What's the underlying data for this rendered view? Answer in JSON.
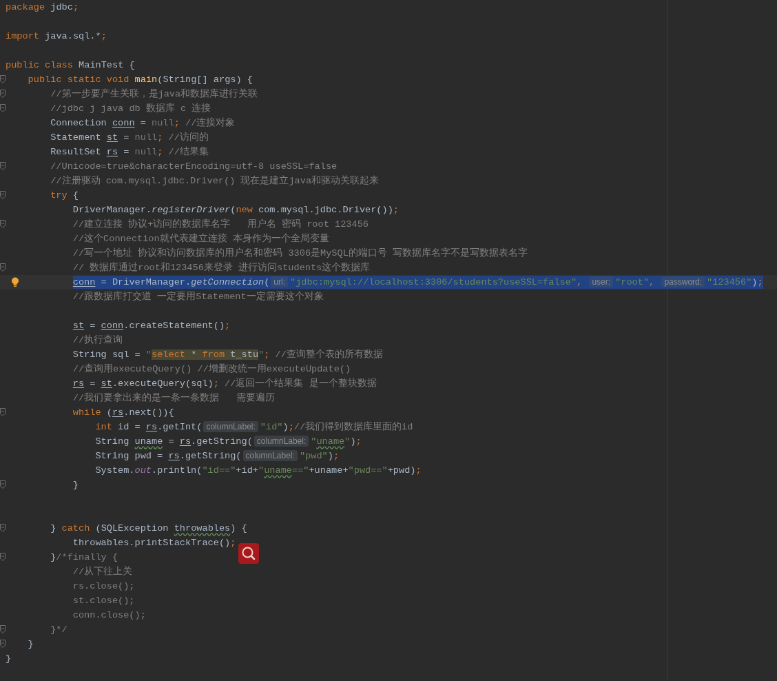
{
  "editor": {
    "lines": [
      {
        "kind": "code",
        "fold": false,
        "selected": false,
        "tokens": [
          {
            "kind": "kw",
            "text": "package"
          },
          {
            "kind": "plain",
            "text": " jdbc"
          },
          {
            "kind": "punct",
            "text": ";"
          }
        ]
      },
      {
        "kind": "blank"
      },
      {
        "kind": "code",
        "fold": false,
        "selected": false,
        "tokens": [
          {
            "kind": "kw",
            "text": "import"
          },
          {
            "kind": "plain",
            "text": " java.sql.*"
          },
          {
            "kind": "punct",
            "text": ";"
          }
        ]
      },
      {
        "kind": "blank"
      },
      {
        "kind": "code",
        "fold": false,
        "selected": false,
        "tokens": [
          {
            "kind": "kw",
            "text": "public class"
          },
          {
            "kind": "plain",
            "text": " MainTest {"
          }
        ],
        "children": [
          {
            "kind": "code",
            "fold": true,
            "selected": false,
            "tokens": [
              {
                "kind": "kw",
                "text": "public static void "
              },
              {
                "kind": "decl",
                "text": "main"
              },
              {
                "kind": "plain",
                "text": "(String[] args) {"
              }
            ],
            "children": [
              {
                "kind": "code",
                "fold": true,
                "selected": false,
                "tokens": [
                  {
                    "kind": "comment",
                    "text": "//第一步要产生关联，是java和数据库进行关联"
                  }
                ]
              },
              {
                "kind": "code",
                "fold": true,
                "selected": false,
                "tokens": [
                  {
                    "kind": "comment",
                    "text": "//jdbc j java db 数据库 c 连接"
                  }
                ]
              },
              {
                "kind": "code",
                "fold": false,
                "selected": false,
                "tokens": [
                  {
                    "kind": "plain",
                    "text": "Connection "
                  },
                  {
                    "kind": "var",
                    "text": "conn"
                  },
                  {
                    "kind": "plain",
                    "text": " = "
                  },
                  {
                    "kind": "null",
                    "text": "null"
                  },
                  {
                    "kind": "punct",
                    "text": "; "
                  },
                  {
                    "kind": "comment",
                    "text": "//连接对象"
                  }
                ]
              },
              {
                "kind": "code",
                "fold": false,
                "selected": false,
                "tokens": [
                  {
                    "kind": "plain",
                    "text": "Statement "
                  },
                  {
                    "kind": "var",
                    "text": "st"
                  },
                  {
                    "kind": "plain",
                    "text": " = "
                  },
                  {
                    "kind": "null",
                    "text": "null"
                  },
                  {
                    "kind": "punct",
                    "text": "; "
                  },
                  {
                    "kind": "comment",
                    "text": "//访问的"
                  }
                ]
              },
              {
                "kind": "code",
                "fold": false,
                "selected": false,
                "tokens": [
                  {
                    "kind": "plain",
                    "text": "ResultSet "
                  },
                  {
                    "kind": "var",
                    "text": "rs"
                  },
                  {
                    "kind": "plain",
                    "text": " = "
                  },
                  {
                    "kind": "null",
                    "text": "null"
                  },
                  {
                    "kind": "punct",
                    "text": "; "
                  },
                  {
                    "kind": "comment",
                    "text": "//结果集"
                  }
                ]
              },
              {
                "kind": "code",
                "fold": true,
                "selected": false,
                "tokens": [
                  {
                    "kind": "comment",
                    "text": "//Unicode=true&characterEncoding=utf-8 useSSL=false"
                  }
                ]
              },
              {
                "kind": "code",
                "fold": false,
                "selected": false,
                "tokens": [
                  {
                    "kind": "comment",
                    "text": "//注册驱动 com.mysql.jdbc.Driver() 现在是建立java和驱动关联起来"
                  }
                ]
              },
              {
                "kind": "code",
                "fold": true,
                "selected": false,
                "tokens": [
                  {
                    "kind": "kw",
                    "text": "try"
                  },
                  {
                    "kind": "plain",
                    "text": " {"
                  }
                ],
                "children": [
                  {
                    "kind": "code",
                    "fold": false,
                    "selected": false,
                    "tokens": [
                      {
                        "kind": "plain",
                        "text": "DriverManager."
                      },
                      {
                        "kind": "italic",
                        "text": "registerDriver"
                      },
                      {
                        "kind": "plain",
                        "text": "("
                      },
                      {
                        "kind": "kw",
                        "text": "new"
                      },
                      {
                        "kind": "plain",
                        "text": " com.mysql.jdbc.Driver())"
                      },
                      {
                        "kind": "punct",
                        "text": ";"
                      }
                    ]
                  },
                  {
                    "kind": "code",
                    "fold": true,
                    "selected": false,
                    "tokens": [
                      {
                        "kind": "comment",
                        "text": "//建立连接 协议+访问的数据库名字   用户名 密码 root 123456"
                      }
                    ]
                  },
                  {
                    "kind": "code",
                    "fold": false,
                    "selected": false,
                    "tokens": [
                      {
                        "kind": "comment",
                        "text": "//这个Connection就代表建立连接 本身作为一个全局变量"
                      }
                    ]
                  },
                  {
                    "kind": "code",
                    "fold": false,
                    "selected": false,
                    "tokens": [
                      {
                        "kind": "comment",
                        "text": "//写一个地址 协议和访问数据库的用户名和密码 3306是MySQL的端口号 写数据库名字不是写数据表名字"
                      }
                    ]
                  },
                  {
                    "kind": "code",
                    "fold": true,
                    "selected": false,
                    "tokens": [
                      {
                        "kind": "comment",
                        "text": "// 数据库通过root和123456来登录 进行访问students这个数据库"
                      }
                    ]
                  },
                  {
                    "kind": "code",
                    "fold": false,
                    "selected": true,
                    "tokens": [
                      {
                        "kind": "var",
                        "text": "conn"
                      },
                      {
                        "kind": "plain",
                        "text": " = DriverManager."
                      },
                      {
                        "kind": "italic",
                        "text": "getConnection"
                      },
                      {
                        "kind": "plain",
                        "text": "("
                      },
                      {
                        "kind": "hint",
                        "text": "url:"
                      },
                      {
                        "kind": "str",
                        "text": "\"jdbc:mysql://localhost:3306/students?useSSL=false\""
                      },
                      {
                        "kind": "punct",
                        "text": ", "
                      },
                      {
                        "kind": "hint",
                        "text": "user:"
                      },
                      {
                        "kind": "str",
                        "text": "\"root\""
                      },
                      {
                        "kind": "punct",
                        "text": ", "
                      },
                      {
                        "kind": "hint",
                        "text": "password:"
                      },
                      {
                        "kind": "str",
                        "text": "\"123456\""
                      },
                      {
                        "kind": "plain",
                        "text": ")"
                      },
                      {
                        "kind": "punct",
                        "text": ";"
                      }
                    ]
                  },
                  {
                    "kind": "code",
                    "fold": false,
                    "selected": false,
                    "tokens": [
                      {
                        "kind": "comment",
                        "text": "//跟数据库打交道 一定要用Statement一定需要这个对象"
                      }
                    ]
                  },
                  {
                    "kind": "blank"
                  },
                  {
                    "kind": "code",
                    "fold": false,
                    "selected": false,
                    "tokens": [
                      {
                        "kind": "var",
                        "text": "st"
                      },
                      {
                        "kind": "plain",
                        "text": " = "
                      },
                      {
                        "kind": "var",
                        "text": "conn"
                      },
                      {
                        "kind": "plain",
                        "text": ".createStatement()"
                      },
                      {
                        "kind": "punct",
                        "text": ";"
                      }
                    ]
                  },
                  {
                    "kind": "code",
                    "fold": false,
                    "selected": false,
                    "tokens": [
                      {
                        "kind": "comment",
                        "text": "//执行查询"
                      }
                    ]
                  },
                  {
                    "kind": "code",
                    "fold": false,
                    "selected": false,
                    "tokens": [
                      {
                        "kind": "plain",
                        "text": "String sql = "
                      },
                      {
                        "kind": "str",
                        "text": "\""
                      },
                      {
                        "kind": "sqlkw",
                        "text": "select"
                      },
                      {
                        "kind": "sql",
                        "text": " * "
                      },
                      {
                        "kind": "sqlkw",
                        "text": "from"
                      },
                      {
                        "kind": "sql",
                        "text": " t_stu"
                      },
                      {
                        "kind": "str",
                        "text": "\""
                      },
                      {
                        "kind": "punct",
                        "text": "; "
                      },
                      {
                        "kind": "comment",
                        "text": "//查询整个表的所有数据"
                      }
                    ]
                  },
                  {
                    "kind": "code",
                    "fold": false,
                    "selected": false,
                    "tokens": [
                      {
                        "kind": "comment",
                        "text": "//查询用executeQuery() //增删改统一用executeUpdate()"
                      }
                    ]
                  },
                  {
                    "kind": "code",
                    "fold": false,
                    "selected": false,
                    "tokens": [
                      {
                        "kind": "var",
                        "text": "rs"
                      },
                      {
                        "kind": "plain",
                        "text": " = "
                      },
                      {
                        "kind": "var",
                        "text": "st"
                      },
                      {
                        "kind": "plain",
                        "text": ".executeQuery(sql)"
                      },
                      {
                        "kind": "punct",
                        "text": "; "
                      },
                      {
                        "kind": "comment",
                        "text": "//返回一个结果集 是一个整块数据"
                      }
                    ]
                  },
                  {
                    "kind": "code",
                    "fold": false,
                    "selected": false,
                    "tokens": [
                      {
                        "kind": "comment",
                        "text": "//我们要拿出来的是一条一条数据   需要遍历"
                      }
                    ]
                  },
                  {
                    "kind": "code",
                    "fold": true,
                    "selected": false,
                    "tokens": [
                      {
                        "kind": "kw",
                        "text": "while"
                      },
                      {
                        "kind": "plain",
                        "text": " ("
                      },
                      {
                        "kind": "var",
                        "text": "rs"
                      },
                      {
                        "kind": "plain",
                        "text": ".next()){"
                      }
                    ],
                    "children": [
                      {
                        "kind": "code",
                        "fold": false,
                        "selected": false,
                        "tokens": [
                          {
                            "kind": "kw",
                            "text": "int"
                          },
                          {
                            "kind": "plain",
                            "text": " id = "
                          },
                          {
                            "kind": "var",
                            "text": "rs"
                          },
                          {
                            "kind": "plain",
                            "text": ".getInt("
                          },
                          {
                            "kind": "hint",
                            "text": "columnLabel:"
                          },
                          {
                            "kind": "str",
                            "text": "\"id\""
                          },
                          {
                            "kind": "plain",
                            "text": ")"
                          },
                          {
                            "kind": "punct",
                            "text": ";"
                          },
                          {
                            "kind": "comment",
                            "text": "//我们得到数据库里面的id"
                          }
                        ]
                      },
                      {
                        "kind": "code",
                        "fold": false,
                        "selected": false,
                        "tokens": [
                          {
                            "kind": "plain",
                            "text": "String "
                          },
                          {
                            "kind": "typo",
                            "text": "uname"
                          },
                          {
                            "kind": "plain",
                            "text": " = "
                          },
                          {
                            "kind": "var",
                            "text": "rs"
                          },
                          {
                            "kind": "plain",
                            "text": ".getString("
                          },
                          {
                            "kind": "hint",
                            "text": "columnLabel:"
                          },
                          {
                            "kind": "str",
                            "text": "\""
                          },
                          {
                            "kind": "strtypo",
                            "text": "uname"
                          },
                          {
                            "kind": "str",
                            "text": "\""
                          },
                          {
                            "kind": "plain",
                            "text": ")"
                          },
                          {
                            "kind": "punct",
                            "text": ";"
                          }
                        ]
                      },
                      {
                        "kind": "code",
                        "fold": false,
                        "selected": false,
                        "tokens": [
                          {
                            "kind": "plain",
                            "text": "String pwd = "
                          },
                          {
                            "kind": "var",
                            "text": "rs"
                          },
                          {
                            "kind": "plain",
                            "text": ".getString("
                          },
                          {
                            "kind": "hint",
                            "text": "columnLabel:"
                          },
                          {
                            "kind": "str",
                            "text": "\"pwd\""
                          },
                          {
                            "kind": "plain",
                            "text": ")"
                          },
                          {
                            "kind": "punct",
                            "text": ";"
                          }
                        ]
                      },
                      {
                        "kind": "code",
                        "fold": false,
                        "selected": false,
                        "tokens": [
                          {
                            "kind": "plain",
                            "text": "System."
                          },
                          {
                            "kind": "field",
                            "text": "out"
                          },
                          {
                            "kind": "plain",
                            "text": ".println("
                          },
                          {
                            "kind": "str",
                            "text": "\"id==\""
                          },
                          {
                            "kind": "plain",
                            "text": "+id+"
                          },
                          {
                            "kind": "str",
                            "text": "\""
                          },
                          {
                            "kind": "strtypo",
                            "text": "uname"
                          },
                          {
                            "kind": "str",
                            "text": "==\""
                          },
                          {
                            "kind": "plain",
                            "text": "+uname+"
                          },
                          {
                            "kind": "str",
                            "text": "\"pwd==\""
                          },
                          {
                            "kind": "plain",
                            "text": "+pwd)"
                          },
                          {
                            "kind": "punct",
                            "text": ";"
                          }
                        ]
                      }
                    ]
                  },
                  {
                    "kind": "code",
                    "fold": true,
                    "selected": false,
                    "tokens": [
                      {
                        "kind": "plain",
                        "text": "}"
                      }
                    ]
                  },
                  {
                    "kind": "blank"
                  },
                  {
                    "kind": "blank"
                  }
                ]
              },
              {
                "kind": "code",
                "fold": true,
                "selected": false,
                "tokens": [
                  {
                    "kind": "plain",
                    "text": "} "
                  },
                  {
                    "kind": "kw",
                    "text": "catch"
                  },
                  {
                    "kind": "plain",
                    "text": " (SQLException "
                  },
                  {
                    "kind": "typo",
                    "text": "throwables"
                  },
                  {
                    "kind": "plain",
                    "text": ") {"
                  }
                ],
                "children": [
                  {
                    "kind": "code",
                    "fold": false,
                    "selected": false,
                    "tokens": [
                      {
                        "kind": "plain",
                        "text": "throwables.printStackTrace()"
                      },
                      {
                        "kind": "punct",
                        "text": ";"
                      }
                    ]
                  }
                ]
              },
              {
                "kind": "code",
                "fold": true,
                "selected": false,
                "tokens": [
                  {
                    "kind": "plain",
                    "text": "}"
                  },
                  {
                    "kind": "comment",
                    "text": "/*finally {"
                  }
                ],
                "children": [
                  {
                    "kind": "code",
                    "fold": false,
                    "selected": false,
                    "tokens": [
                      {
                        "kind": "comment",
                        "text": "//从下往上关"
                      }
                    ]
                  },
                  {
                    "kind": "code",
                    "fold": false,
                    "selected": false,
                    "tokens": [
                      {
                        "kind": "comment",
                        "text": "rs.close();"
                      }
                    ]
                  },
                  {
                    "kind": "code",
                    "fold": false,
                    "selected": false,
                    "tokens": [
                      {
                        "kind": "comment",
                        "text": "st.close();"
                      }
                    ]
                  },
                  {
                    "kind": "code",
                    "fold": false,
                    "selected": false,
                    "tokens": [
                      {
                        "kind": "comment",
                        "text": "conn.close();"
                      }
                    ]
                  }
                ]
              },
              {
                "kind": "code",
                "fold": true,
                "selected": false,
                "tokens": [
                  {
                    "kind": "comment",
                    "text": "}*/"
                  }
                ]
              }
            ]
          },
          {
            "kind": "code",
            "fold": true,
            "selected": false,
            "tokens": [
              {
                "kind": "plain",
                "text": "}"
              }
            ]
          }
        ]
      },
      {
        "kind": "code",
        "fold": false,
        "selected": false,
        "tokens": [
          {
            "kind": "plain",
            "text": "}"
          }
        ]
      }
    ]
  }
}
